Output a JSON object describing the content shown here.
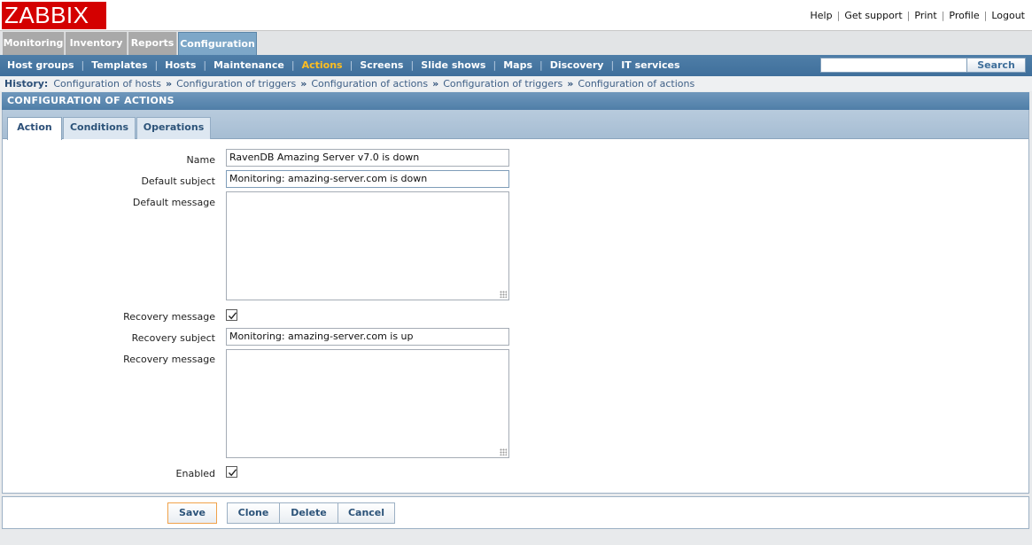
{
  "brand": {
    "logo": "ZABBIX",
    "logo_color": "#d40000"
  },
  "top_links": [
    "Help",
    "Get support",
    "Print",
    "Profile",
    "Logout"
  ],
  "main_menu": [
    "Monitoring",
    "Inventory",
    "Reports",
    "Configuration"
  ],
  "main_menu_active": "Configuration",
  "sub_menu": [
    "Host groups",
    "Templates",
    "Hosts",
    "Maintenance",
    "Actions",
    "Screens",
    "Slide shows",
    "Maps",
    "Discovery",
    "IT services"
  ],
  "sub_menu_active": "Actions",
  "search": {
    "value": "",
    "button": "Search"
  },
  "history": {
    "label": "History:",
    "items": [
      "Configuration of hosts",
      "Configuration of triggers",
      "Configuration of actions",
      "Configuration of triggers",
      "Configuration of actions"
    ],
    "separator": "»"
  },
  "page_title": "CONFIGURATION OF ACTIONS",
  "form_tabs": [
    "Action",
    "Conditions",
    "Operations"
  ],
  "form_tab_active": "Action",
  "form": {
    "name_label": "Name",
    "name_value": "RavenDB Amazing Server v7.0 is down",
    "default_subject_label": "Default subject",
    "default_subject_value": "Monitoring: amazing-server.com is down",
    "default_message_label": "Default message",
    "default_message_value": "",
    "recovery_message_toggle_label": "Recovery message",
    "recovery_message_checked": true,
    "recovery_subject_label": "Recovery subject",
    "recovery_subject_value": "Monitoring: amazing-server.com is up",
    "recovery_message_label": "Recovery message",
    "recovery_message_value": "",
    "enabled_label": "Enabled",
    "enabled_checked": true
  },
  "buttons": {
    "save": "Save",
    "clone": "Clone",
    "delete": "Delete",
    "cancel": "Cancel"
  }
}
